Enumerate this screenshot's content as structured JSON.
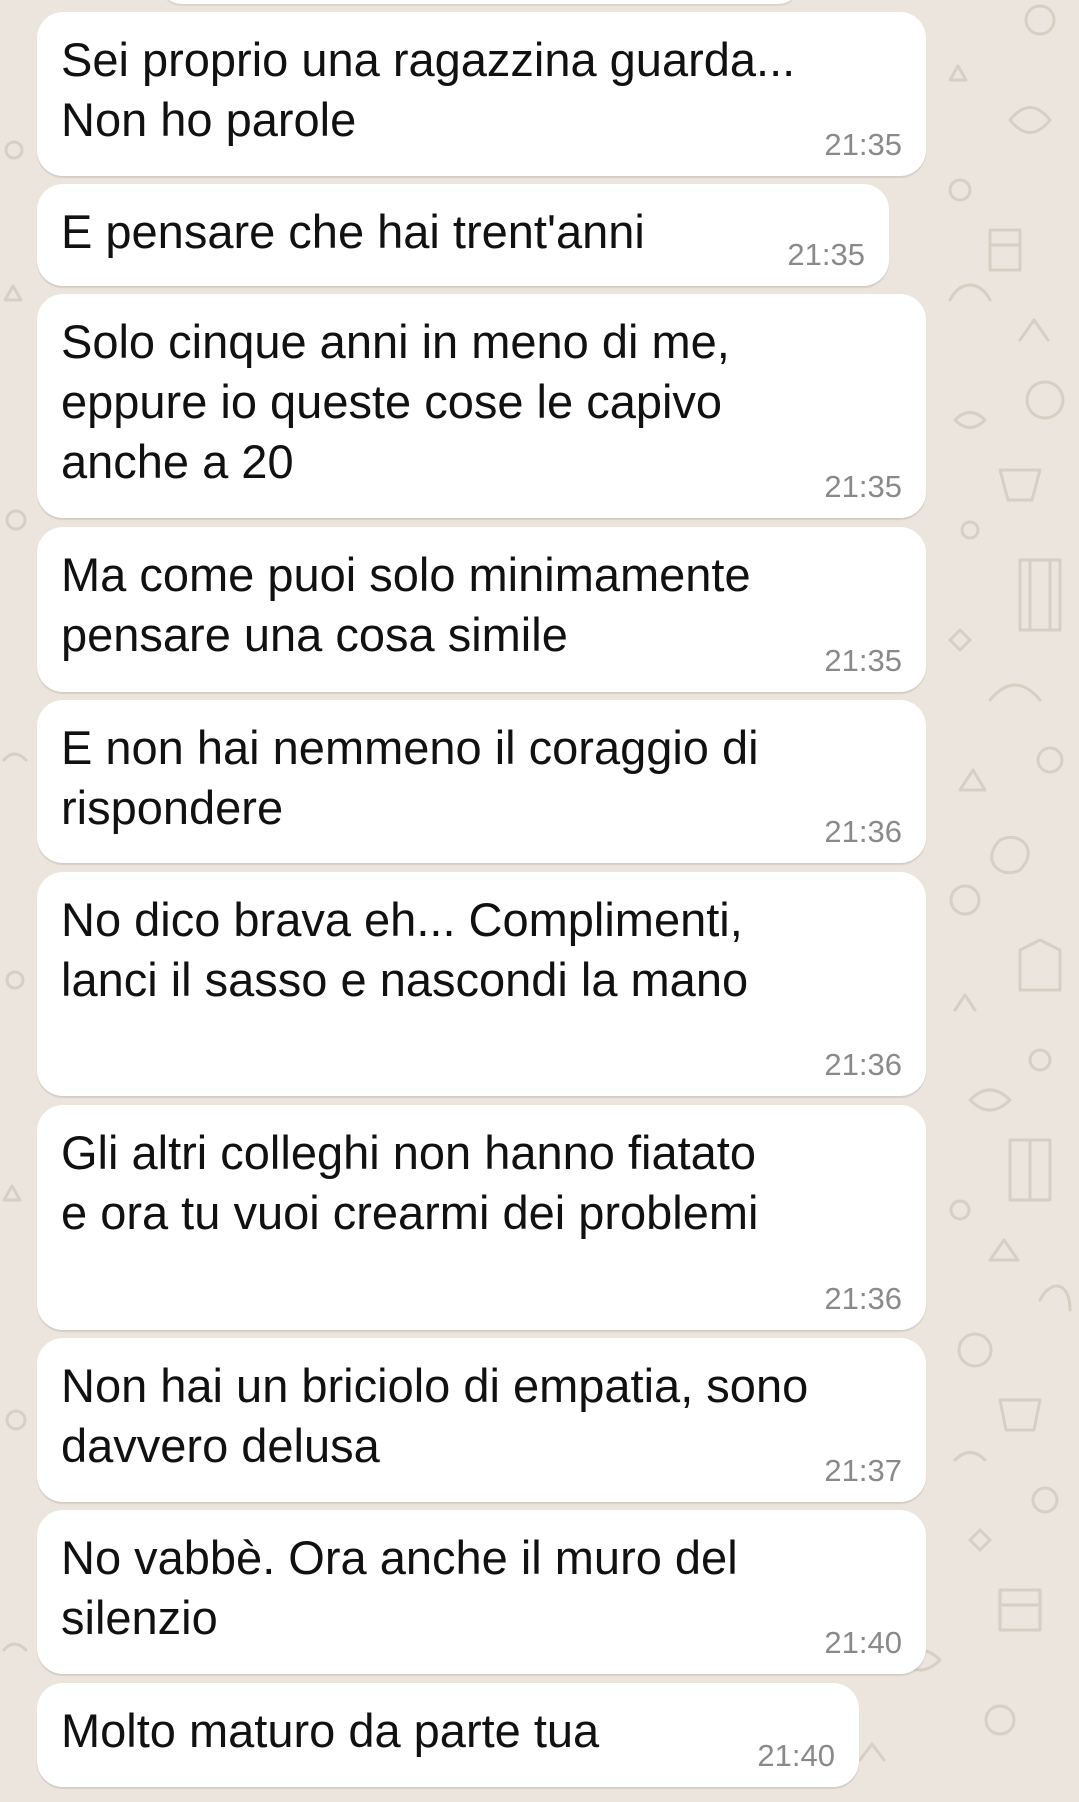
{
  "theme": {
    "background": "#ece5dd",
    "bubble": "#ffffff",
    "text": "#111111",
    "time": "#8a8a8a"
  },
  "messages": [
    {
      "text": "Sei proprio una ragazzina guarda...\nNon ho parole",
      "time": "21:35"
    },
    {
      "text": "E pensare che hai trent'anni",
      "time": "21:35"
    },
    {
      "text": "Solo cinque anni in meno di me,\neppure io queste cose le capivo\nanche a 20",
      "time": "21:35"
    },
    {
      "text": "Ma come puoi solo minimamente\npensare una cosa simile",
      "time": "21:35"
    },
    {
      "text": "E non hai nemmeno il coraggio di\nrispondere",
      "time": "21:36"
    },
    {
      "text": "No dico brava eh... Complimenti,\nlanci il sasso e nascondi la mano",
      "time": "21:36"
    },
    {
      "text": "Gli altri colleghi non hanno fiatato\ne ora tu vuoi crearmi dei problemi",
      "time": "21:36"
    },
    {
      "text": "Non hai un briciolo di empatia, sono\ndavvero delusa",
      "time": "21:37"
    },
    {
      "text": "No vabbè. Ora anche il muro del\nsilenzio",
      "time": "21:40"
    },
    {
      "text": "Molto maturo da parte tua",
      "time": "21:40"
    }
  ]
}
